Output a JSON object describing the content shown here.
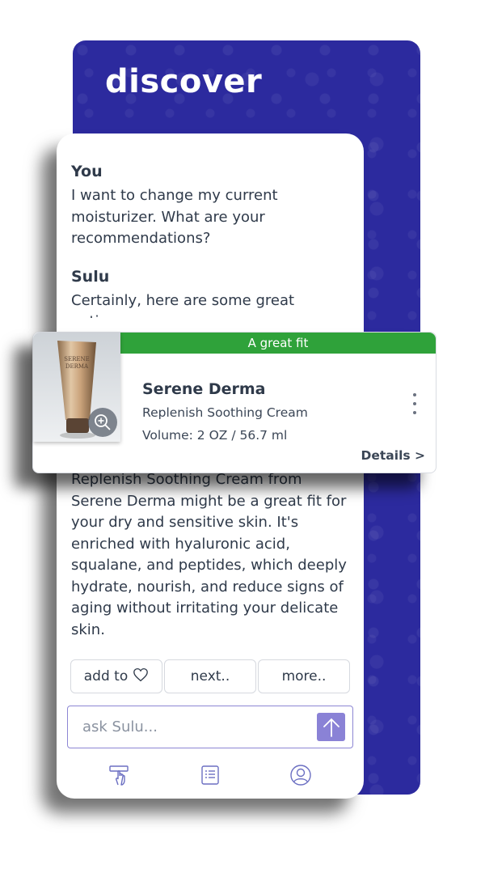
{
  "header": {
    "title": "discover"
  },
  "chat": {
    "user_name": "You",
    "user_message": "I want to change my current moisturizer. What are your recommendations?",
    "assistant_name": "Sulu",
    "assistant_intro": "Certainly, here are some great options:",
    "assistant_detail": "Replenish Soothing Cream from Serene Derma might be a great fit for your dry and sensitive skin. It's enriched with hyaluronic acid, squalane, and peptides, which deeply hydrate, nourish, and reduce signs of aging without irritating your delicate skin."
  },
  "product": {
    "badge": "A great fit",
    "brand": "Serene Derma",
    "name": "Replenish Soothing Cream",
    "volume": "Volume: 2 OZ / 56.7 ml",
    "details_link": "Details >",
    "tube_label_line1": "SERENE",
    "tube_label_line2": "DERMA"
  },
  "actions": {
    "add_to": "add to",
    "next": "next..",
    "more": "more.."
  },
  "ask": {
    "placeholder": "ask Sulu..."
  },
  "nav": {
    "items": [
      "tap-hand-icon",
      "list-icon",
      "profile-icon"
    ]
  },
  "colors": {
    "panel_bg": "#2c2a9e",
    "badge_green": "#2fa23a",
    "send_button": "#8a82d6",
    "text_dark": "#2f3a4a"
  }
}
